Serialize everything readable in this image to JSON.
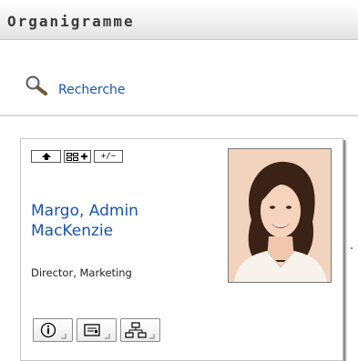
{
  "header": {
    "title": "Organigramme"
  },
  "search": {
    "icon": "magnifier-icon",
    "link_label": "Recherche"
  },
  "card": {
    "toolbar": {
      "up_icon": "arrow-up-icon",
      "expand_icon": "org-tree-add-icon",
      "toggle_label": "+/−"
    },
    "name": "Margo, Admin MacKenzie",
    "job_title": "Director, Marketing",
    "photo": "person-photo",
    "actions": [
      {
        "icon": "info-icon"
      },
      {
        "icon": "card-icon"
      },
      {
        "icon": "org-chart-icon"
      }
    ]
  },
  "colors": {
    "link": "#1a56a8",
    "header_text": "#3a3a3a"
  }
}
